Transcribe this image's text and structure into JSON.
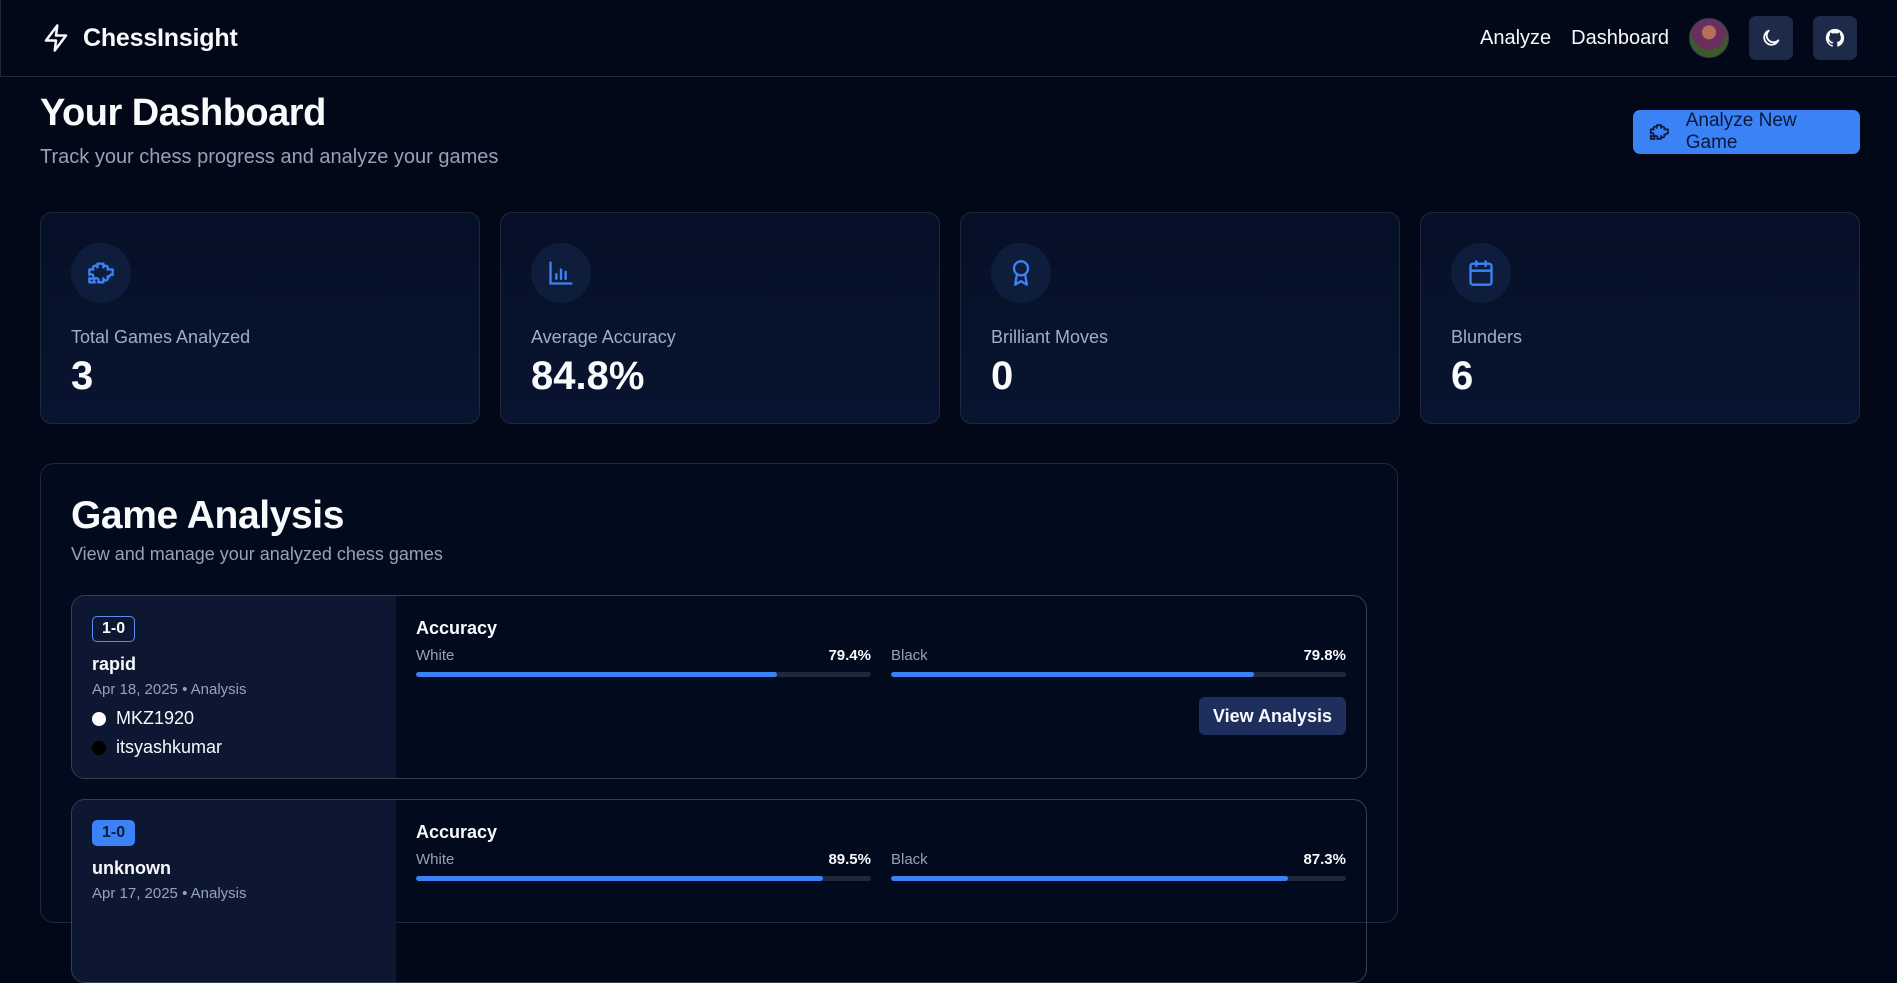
{
  "brand": {
    "name": "ChessInsight",
    "icon": "bolt-icon"
  },
  "nav": {
    "analyze": "Analyze",
    "dashboard": "Dashboard"
  },
  "header": {
    "title": "Your Dashboard",
    "subtitle": "Track your chess progress and analyze your games",
    "analyze_button": "Analyze New Game"
  },
  "stats": [
    {
      "label": "Total Games Analyzed",
      "value": "3",
      "icon": "puzzle-icon"
    },
    {
      "label": "Average Accuracy",
      "value": "84.8%",
      "icon": "bar-chart-icon"
    },
    {
      "label": "Brilliant Moves",
      "value": "0",
      "icon": "award-icon"
    },
    {
      "label": "Blunders",
      "value": "6",
      "icon": "calendar-icon"
    }
  ],
  "games_panel": {
    "title": "Game Analysis",
    "subtitle": "View and manage your analyzed chess games",
    "accuracy_label": "Accuracy",
    "white_label": "White",
    "black_label": "Black",
    "view_button": "View Analysis",
    "games": [
      {
        "result": "1-0",
        "type": "rapid",
        "date": "Apr 18, 2025 • Analysis",
        "white_player": "MKZ1920",
        "black_player": "itsyashkumar",
        "white_accuracy": "79.4%",
        "black_accuracy": "79.8%",
        "white_accuracy_value": 79.4,
        "black_accuracy_value": 79.8
      },
      {
        "result": "1-0",
        "type": "unknown",
        "date": "Apr 17, 2025 • Analysis",
        "white_accuracy": "89.5%",
        "black_accuracy": "87.3%",
        "white_accuracy_value": 89.5,
        "black_accuracy_value": 87.3
      }
    ]
  },
  "colors": {
    "accent": "#3b82f6",
    "background": "#020817"
  }
}
